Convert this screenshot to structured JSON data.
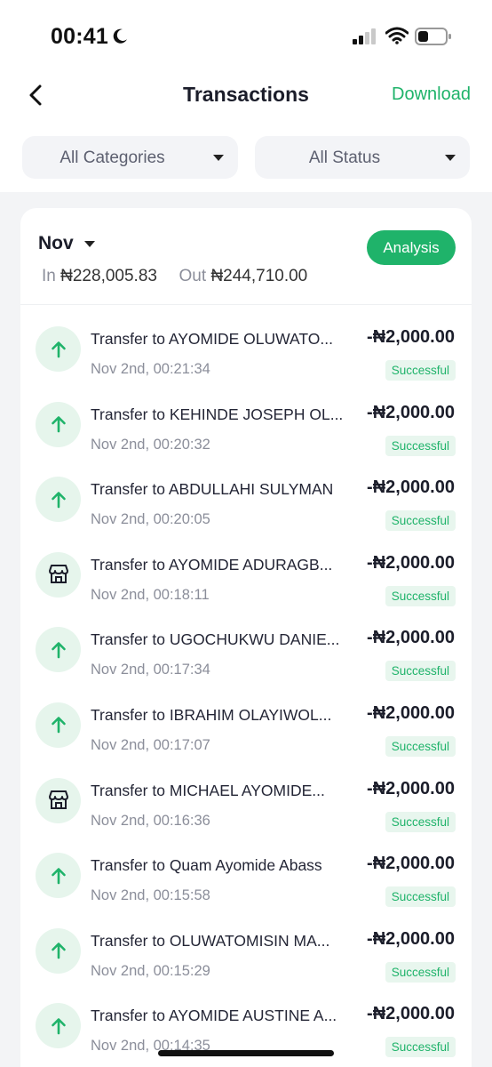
{
  "status_bar": {
    "time": "00:41"
  },
  "header": {
    "title": "Transactions",
    "download_label": "Download"
  },
  "filters": {
    "category": "All Categories",
    "status": "All Status"
  },
  "summary": {
    "month": "Nov",
    "in_label": "In",
    "in_amount": "₦228,005.83",
    "out_label": "Out",
    "out_amount": "₦244,710.00",
    "analysis_label": "Analysis"
  },
  "transactions": [
    {
      "icon": "arrow-up-icon",
      "name": "Transfer to AYOMIDE OLUWATO...",
      "date": "Nov 2nd, 00:21:34",
      "amount": "-₦2,000.00",
      "status": "Successful"
    },
    {
      "icon": "arrow-up-icon",
      "name": "Transfer to KEHINDE JOSEPH OL...",
      "date": "Nov 2nd, 00:20:32",
      "amount": "-₦2,000.00",
      "status": "Successful"
    },
    {
      "icon": "arrow-up-icon",
      "name": "Transfer to ABDULLAHI SULYMAN",
      "date": "Nov 2nd, 00:20:05",
      "amount": "-₦2,000.00",
      "status": "Successful"
    },
    {
      "icon": "store-icon",
      "name": "Transfer to AYOMIDE ADURAGB...",
      "date": "Nov 2nd, 00:18:11",
      "amount": "-₦2,000.00",
      "status": "Successful"
    },
    {
      "icon": "arrow-up-icon",
      "name": "Transfer to UGOCHUKWU DANIE...",
      "date": "Nov 2nd, 00:17:34",
      "amount": "-₦2,000.00",
      "status": "Successful"
    },
    {
      "icon": "arrow-up-icon",
      "name": "Transfer to IBRAHIM OLAYIWOL...",
      "date": "Nov 2nd, 00:17:07",
      "amount": "-₦2,000.00",
      "status": "Successful"
    },
    {
      "icon": "store-icon",
      "name": "Transfer to MICHAEL AYOMIDE...",
      "date": "Nov 2nd, 00:16:36",
      "amount": "-₦2,000.00",
      "status": "Successful"
    },
    {
      "icon": "arrow-up-icon",
      "name": "Transfer to Quam Ayomide Abass",
      "date": "Nov 2nd, 00:15:58",
      "amount": "-₦2,000.00",
      "status": "Successful"
    },
    {
      "icon": "arrow-up-icon",
      "name": "Transfer to OLUWATOMISIN MA...",
      "date": "Nov 2nd, 00:15:29",
      "amount": "-₦2,000.00",
      "status": "Successful"
    },
    {
      "icon": "arrow-up-icon",
      "name": "Transfer to AYOMIDE AUSTINE A...",
      "date": "Nov 2nd, 00:14:35",
      "amount": "-₦2,000.00",
      "status": "Successful"
    }
  ],
  "colors": {
    "accent": "#1fb36a",
    "badge_bg": "#e8f6ee",
    "icon_bg": "#e6f5ec"
  }
}
